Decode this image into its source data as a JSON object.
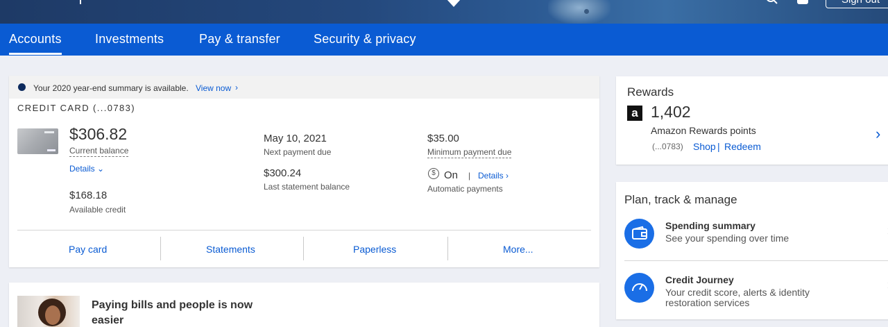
{
  "header": {
    "sign_out_label": "Sign out"
  },
  "nav": {
    "tabs": [
      {
        "label": "Accounts"
      },
      {
        "label": "Investments"
      },
      {
        "label": "Pay & transfer"
      },
      {
        "label": "Security & privacy"
      }
    ]
  },
  "banner": {
    "message": "Your 2020 year-end summary is available.",
    "link": "View now",
    "chevron": "›"
  },
  "credit_card": {
    "title": "CREDIT CARD (...0783)",
    "current_balance": "$306.82",
    "current_balance_label": "Current balance",
    "details_label": "Details ⌄",
    "available_credit": "$168.18",
    "available_credit_label": "Available credit",
    "next_payment_due": "May 10, 2021",
    "next_payment_due_label": "Next payment due",
    "last_statement_balance": "$300.24",
    "last_statement_balance_label": "Last statement balance",
    "minimum_payment_due": "$35.00",
    "minimum_payment_due_label": "Minimum payment due",
    "autopay_icon": "$",
    "autopay_status": "On",
    "autopay_sep": "|",
    "autopay_details": "Details ›",
    "autopay_label": "Automatic payments",
    "actions": [
      {
        "label": "Pay card"
      },
      {
        "label": "Statements"
      },
      {
        "label": "Paperless"
      },
      {
        "label": "More..."
      }
    ]
  },
  "promo": {
    "headline": "Paying bills and people is now easier"
  },
  "rewards": {
    "title": "Rewards",
    "logo": "a",
    "points": "1,402",
    "points_label": "Amazon Rewards points",
    "account": "(...0783)",
    "shop": "Shop",
    "sep": "|",
    "redeem": "Redeem",
    "arrow": "›"
  },
  "plan": {
    "title": "Plan, track & manage",
    "items": [
      {
        "title": "Spending summary",
        "subtitle": "See your spending over time",
        "chevron": "›"
      },
      {
        "title": "Credit Journey",
        "subtitle": "Your credit score, alerts & identity restoration services",
        "chevron": "›"
      }
    ]
  },
  "colors": {
    "nav_blue": "#0a5bd3",
    "link_blue": "#0a5bd3",
    "background": "#edeff5"
  },
  "icons": [
    "hamburger-icon",
    "chase-logo-icon",
    "search-icon",
    "user-icon",
    "info-dot-icon",
    "autopay-dollar-icon",
    "amazon-logo-icon",
    "wallet-icon",
    "gauge-icon"
  ]
}
